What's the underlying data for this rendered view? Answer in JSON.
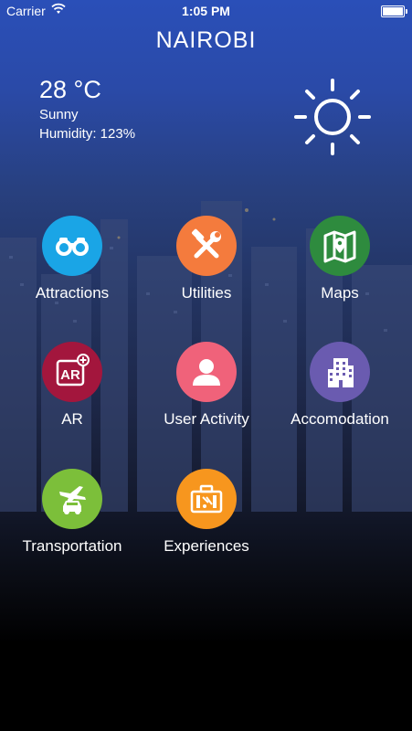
{
  "status_bar": {
    "carrier": "Carrier",
    "time": "1:05 PM"
  },
  "header": {
    "title": "NAIROBI"
  },
  "weather": {
    "temperature": "28 °C",
    "condition": "Sunny",
    "humidity": "Humidity: 123%",
    "icon": "sun-icon"
  },
  "menu": {
    "items": [
      {
        "label": "Attractions",
        "icon": "binoculars-icon",
        "color": "#1aa5e6"
      },
      {
        "label": "Utilities",
        "icon": "tools-icon",
        "color": "#f47b3d"
      },
      {
        "label": "Maps",
        "icon": "map-icon",
        "color": "#2e8b3e"
      },
      {
        "label": "AR",
        "icon": "ar-icon",
        "color": "#a3163d"
      },
      {
        "label": "User Activity",
        "icon": "user-icon",
        "color": "#f0627a"
      },
      {
        "label": "Accomodation",
        "icon": "building-icon",
        "color": "#6a5bb0"
      },
      {
        "label": "Transportation",
        "icon": "transport-icon",
        "color": "#7cbf3a"
      },
      {
        "label": "Experiences",
        "icon": "luggage-icon",
        "color": "#f7961e"
      }
    ]
  }
}
